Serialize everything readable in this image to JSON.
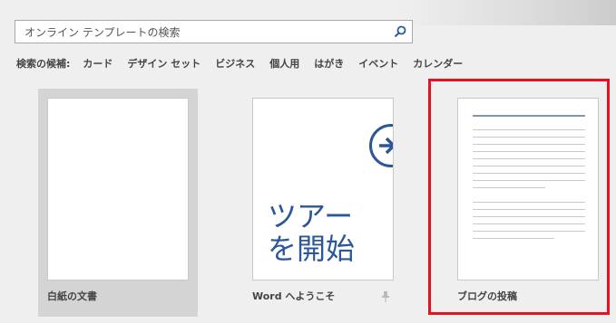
{
  "search": {
    "placeholder": "オンライン テンプレートの検索"
  },
  "suggestions": {
    "label": "検索の候補:",
    "items": [
      "カード",
      "デザイン セット",
      "ビジネス",
      "個人用",
      "はがき",
      "イベント",
      "カレンダー"
    ]
  },
  "templates": [
    {
      "caption": "白紙の文書"
    },
    {
      "caption": "Word へようこそ",
      "thumb_line1": "ツアー",
      "thumb_line2": "を開始"
    },
    {
      "caption": "ブログの投稿"
    }
  ],
  "colors": {
    "accent": "#2b579a",
    "highlight": "#e81123",
    "selected_tile": "#d4d4d4"
  }
}
